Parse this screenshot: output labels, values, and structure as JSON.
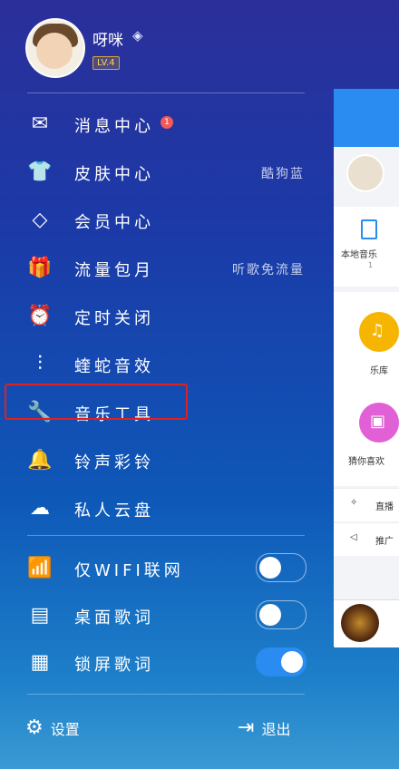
{
  "user": {
    "name": "呀咪",
    "vip_icon": "diamond-icon",
    "level": "LV.4"
  },
  "menu": [
    {
      "icon": "envelope-icon",
      "label": "消息中心",
      "badge": "1",
      "extra": ""
    },
    {
      "icon": "tshirt-icon",
      "label": "皮肤中心",
      "badge": "",
      "extra": "酷狗蓝"
    },
    {
      "icon": "diamond-icon",
      "label": "会员中心",
      "badge": "",
      "extra": ""
    },
    {
      "icon": "gift-icon",
      "label": "流量包月",
      "badge": "",
      "extra": "听歌免流量"
    },
    {
      "icon": "alarm-clock-icon",
      "label": "定时关闭",
      "badge": "",
      "extra": ""
    },
    {
      "icon": "equalizer-icon",
      "label": "蝰蛇音效",
      "badge": "",
      "extra": ""
    },
    {
      "icon": "wrench-icon",
      "label": "音乐工具",
      "badge": "",
      "extra": ""
    },
    {
      "icon": "bell-icon",
      "label": "铃声彩铃",
      "badge": "",
      "extra": ""
    },
    {
      "icon": "cloud-icon",
      "label": "私人云盘",
      "badge": "",
      "extra": ""
    }
  ],
  "toggles": [
    {
      "icon": "wifi-icon",
      "label": "仅WIFI联网",
      "state": "off"
    },
    {
      "icon": "lyrics-icon",
      "label": "桌面歌词",
      "state": "off"
    },
    {
      "icon": "lock-lyrics-icon",
      "label": "锁屏歌词",
      "state": "on"
    }
  ],
  "footer": {
    "settings_label": "设置",
    "exit_label": "退出"
  },
  "behind_panel": {
    "local_music": "本地音乐",
    "local_count": "1",
    "library": "乐库",
    "guess_like": "猜你喜欢",
    "live": "直播",
    "promo": "推广"
  },
  "colors": {
    "accent": "#2a8bf0",
    "badge": "#f05a5a",
    "highlight_border": "#e02020"
  }
}
